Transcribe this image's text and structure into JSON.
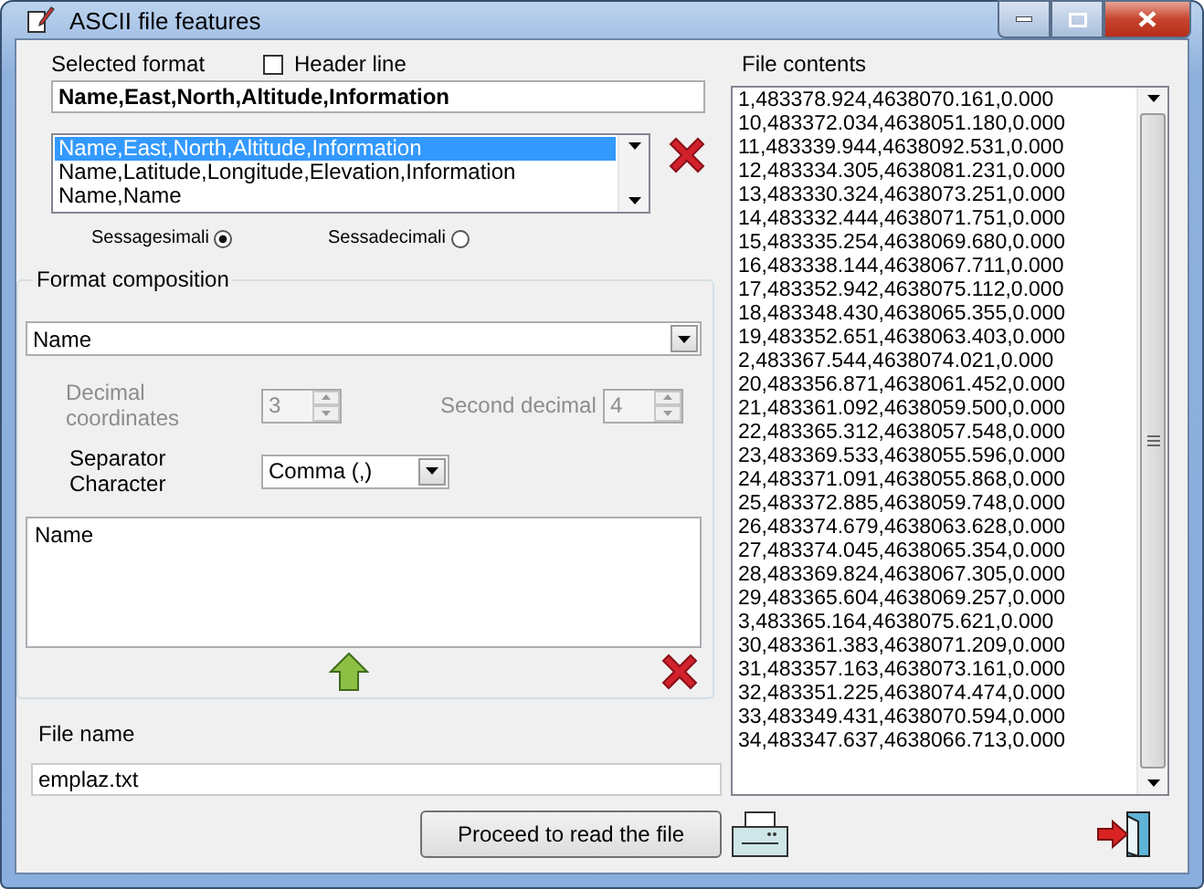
{
  "window": {
    "title": "ASCII file features"
  },
  "selected_format": {
    "label": "Selected format",
    "value": "Name,East,North,Altitude,Information"
  },
  "header_line": {
    "label": "Header line",
    "checked": false
  },
  "formats": [
    {
      "label": "Name,East,North,Altitude,Information",
      "selected": true
    },
    {
      "label": "Name,Latitude,Longitude,Elevation,Information",
      "selected": false
    },
    {
      "label": "Name,Name",
      "selected": false
    }
  ],
  "angle_units": [
    {
      "label": "Sessagesimali",
      "selected": true
    },
    {
      "label": "Sessadecimali",
      "selected": false
    }
  ],
  "format_composition": {
    "title": "Format composition",
    "field": "Name",
    "decimal_coordinates": {
      "label": "Decimal coordinates",
      "value": "3",
      "disabled": true
    },
    "second_decimal": {
      "label": "Second decimal",
      "value": "4",
      "disabled": true
    },
    "separator": {
      "label": "Separator Character",
      "value": "Comma (,)"
    },
    "fields": [
      "Name"
    ]
  },
  "file_name": {
    "label": "File name",
    "value": "emplaz.txt"
  },
  "file_contents": {
    "label": "File contents",
    "lines": [
      "1,483378.924,4638070.161,0.000",
      "10,483372.034,4638051.180,0.000",
      "11,483339.944,4638092.531,0.000",
      "12,483334.305,4638081.231,0.000",
      "13,483330.324,4638073.251,0.000",
      "14,483332.444,4638071.751,0.000",
      "15,483335.254,4638069.680,0.000",
      "16,483338.144,4638067.711,0.000",
      "17,483352.942,4638075.112,0.000",
      "18,483348.430,4638065.355,0.000",
      "19,483352.651,4638063.403,0.000",
      "2,483367.544,4638074.021,0.000",
      "20,483356.871,4638061.452,0.000",
      "21,483361.092,4638059.500,0.000",
      "22,483365.312,4638057.548,0.000",
      "23,483369.533,4638055.596,0.000",
      "24,483371.091,4638055.868,0.000",
      "25,483372.885,4638059.748,0.000",
      "26,483374.679,4638063.628,0.000",
      "27,483374.045,4638065.354,0.000",
      "28,483369.824,4638067.305,0.000",
      "29,483365.604,4638069.257,0.000",
      "3,483365.164,4638075.621,0.000",
      "30,483361.383,4638071.209,0.000",
      "31,483357.163,4638073.161,0.000",
      "32,483351.225,4638074.474,0.000",
      "33,483349.431,4638070.594,0.000",
      "34,483347.637,4638066.713,0.000"
    ]
  },
  "buttons": {
    "proceed": "Proceed to read the file"
  }
}
